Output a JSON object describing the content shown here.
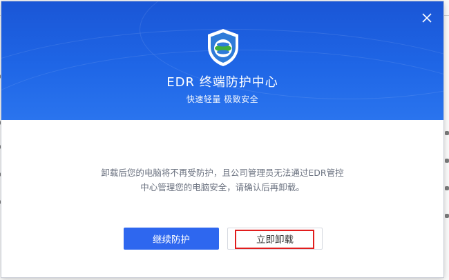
{
  "dialog": {
    "title": "EDR 终端防护中心",
    "subtitle": "快速轻量 极致安全",
    "message_line1": "卸载后您的电脑将不再受防护，且公司管理员无法通过EDR管控",
    "message_line2": "中心管理您的电脑安全，请确认后再卸载。",
    "continue_label": "继续防护",
    "uninstall_label": "立即卸载"
  },
  "colors": {
    "header": "#1f66e6",
    "primary_button": "#2e67ef",
    "highlight": "#e11d1d",
    "logo_shield": "#2f7bd9",
    "logo_green": "#3fae3a"
  },
  "icons": {
    "close": "close-icon",
    "logo": "shield-logo-icon"
  }
}
